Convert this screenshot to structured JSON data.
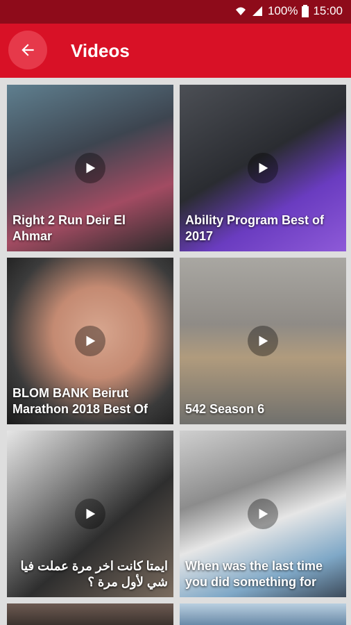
{
  "status": {
    "battery": "100%",
    "time": "15:00"
  },
  "appbar": {
    "title": "Videos"
  },
  "videos": [
    {
      "title": "Right 2 Run Deir El Ahmar"
    },
    {
      "title": "Ability Program Best of 2017"
    },
    {
      "title": "BLOM BANK Beirut Marathon 2018 Best Of"
    },
    {
      "title": "542  Season 6"
    },
    {
      "title": "ايمتا كانت اخر مرة عملت فيا شي لأول مرة ؟"
    },
    {
      "title": "When was the last time you did something for"
    }
  ],
  "colors": {
    "accent": "#d81126",
    "status": "#8e0b1a"
  }
}
